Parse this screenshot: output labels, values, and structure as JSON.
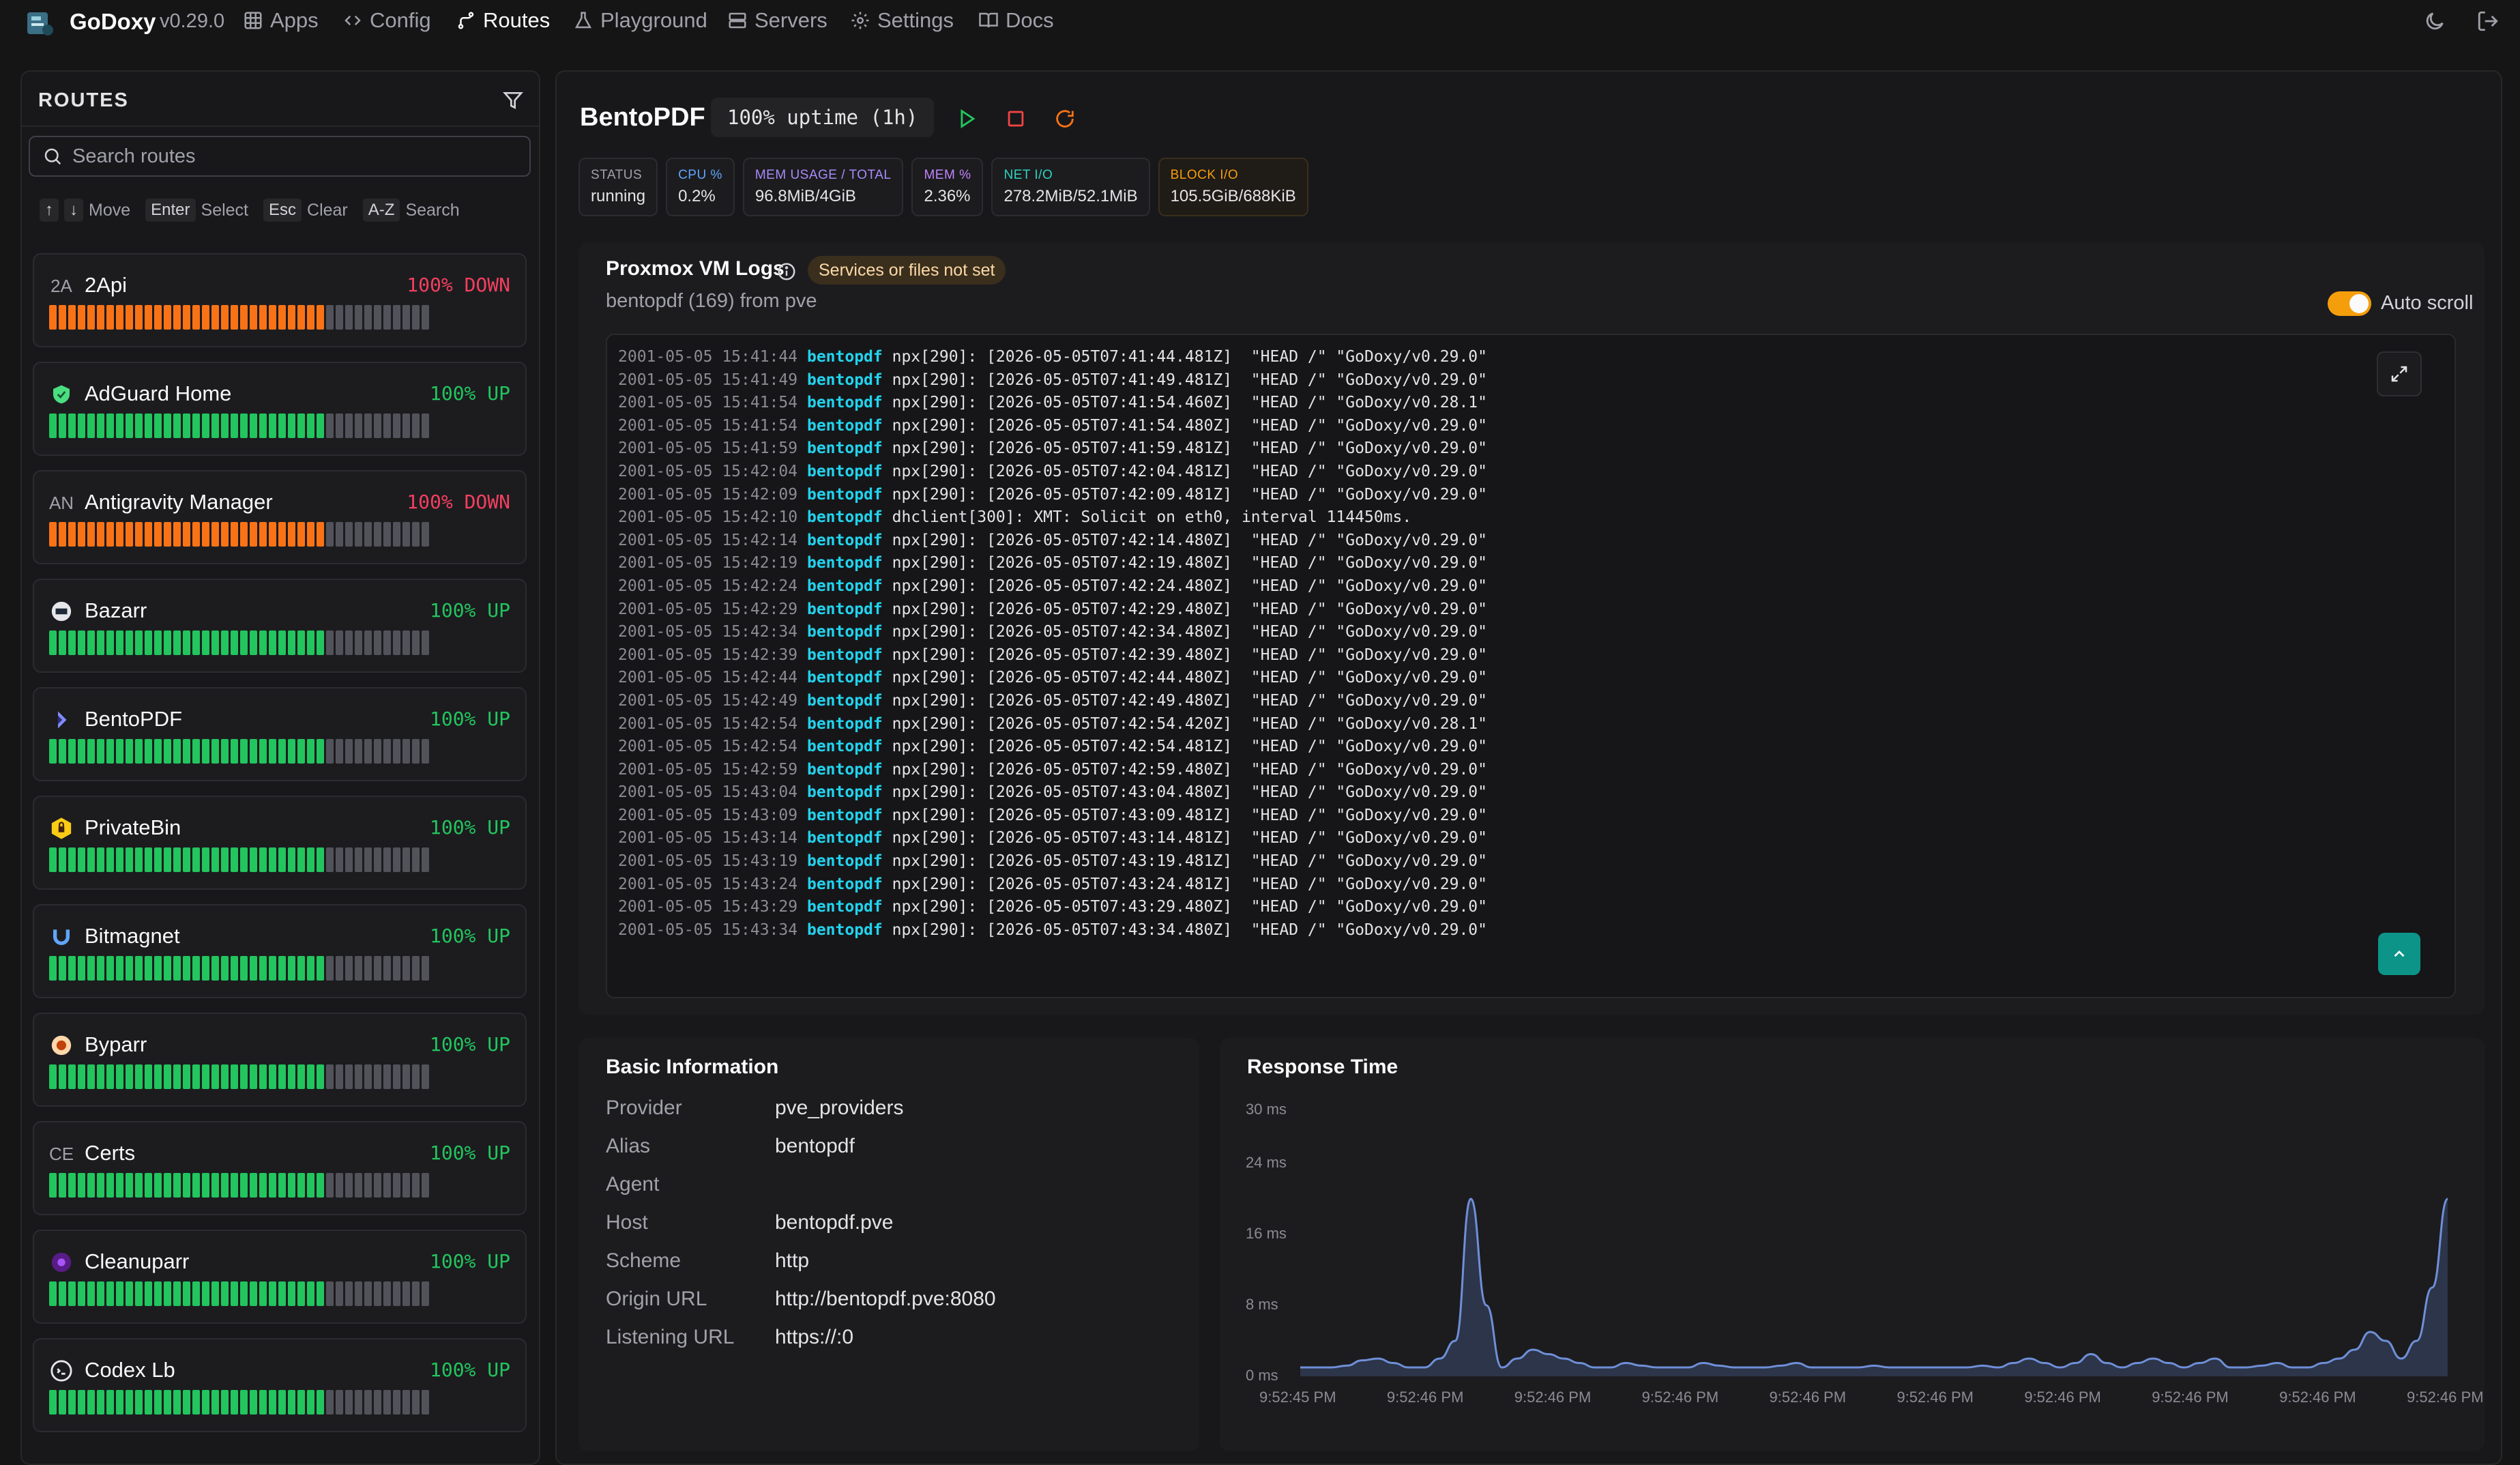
{
  "app": {
    "name": "GoDoxy",
    "version": "v0.29.0"
  },
  "nav": [
    {
      "label": "Apps",
      "icon": "grid-icon",
      "active": false
    },
    {
      "label": "Config",
      "icon": "code-icon",
      "active": false
    },
    {
      "label": "Routes",
      "icon": "route-icon",
      "active": true
    },
    {
      "label": "Playground",
      "icon": "flask-icon",
      "active": false
    },
    {
      "label": "Servers",
      "icon": "server-icon",
      "active": false
    },
    {
      "label": "Settings",
      "icon": "gear-icon",
      "active": false
    },
    {
      "label": "Docs",
      "icon": "book-icon",
      "active": false
    }
  ],
  "sidebar": {
    "title": "ROUTES",
    "search_placeholder": "Search routes",
    "hints": [
      {
        "keys": [
          "↑",
          "↓"
        ],
        "label": "Move"
      },
      {
        "keys": [
          "Enter"
        ],
        "label": "Select"
      },
      {
        "keys": [
          "Esc"
        ],
        "label": "Clear"
      },
      {
        "keys": [
          "A-Z"
        ],
        "label": "Search"
      }
    ],
    "routes": [
      {
        "name": "2Api",
        "icon_text": "2A",
        "status": "100% DOWN",
        "state": "down"
      },
      {
        "name": "AdGuard Home",
        "icon_text": "",
        "icon": "adguard-shield-icon",
        "status": "100% UP",
        "state": "up"
      },
      {
        "name": "Antigravity Manager",
        "icon_text": "AN",
        "status": "100% DOWN",
        "state": "down"
      },
      {
        "name": "Bazarr",
        "icon_text": "",
        "icon": "bazarr-icon",
        "status": "100% UP",
        "state": "up"
      },
      {
        "name": "BentoPDF",
        "icon_text": "",
        "icon": "bentopdf-icon",
        "status": "100% UP",
        "state": "up"
      },
      {
        "name": "PrivateBin",
        "icon_text": "",
        "icon": "privatebin-icon",
        "status": "100% UP",
        "state": "up"
      },
      {
        "name": "Bitmagnet",
        "icon_text": "",
        "icon": "magnet-icon",
        "status": "100% UP",
        "state": "up"
      },
      {
        "name": "Byparr",
        "icon_text": "",
        "icon": "byparr-icon",
        "status": "100% UP",
        "state": "up"
      },
      {
        "name": "Certs",
        "icon_text": "CE",
        "status": "100% UP",
        "state": "up"
      },
      {
        "name": "Cleanuparr",
        "icon_text": "",
        "icon": "cleanuparr-icon",
        "status": "100% UP",
        "state": "up"
      },
      {
        "name": "Codex Lb",
        "icon_text": "",
        "icon": "codex-icon",
        "status": "100% UP",
        "state": "up"
      }
    ]
  },
  "detail": {
    "title": "BentoPDF",
    "uptime": "100% uptime (1h)",
    "stats": [
      {
        "label": "STATUS",
        "value": "running",
        "color": "#a1a1aa"
      },
      {
        "label": "CPU %",
        "value": "0.2%",
        "color": "#60a5fa"
      },
      {
        "label": "MEM USAGE / TOTAL",
        "value": "96.8MiB/4GiB",
        "color": "#a78bfa"
      },
      {
        "label": "MEM %",
        "value": "2.36%",
        "color": "#c084fc"
      },
      {
        "label": "NET I/O",
        "value": "278.2MiB/52.1MiB",
        "color": "#2dd4bf"
      },
      {
        "label": "BLOCK I/O",
        "value": "105.5GiB/688KiB",
        "color": "#f59e0b"
      }
    ]
  },
  "logs": {
    "title": "Proxmox VM Logs",
    "badge": "Services or files not set",
    "subtitle": "bentopdf (169) from pve",
    "auto_scroll_label": "Auto scroll",
    "auto_scroll": true,
    "lines": [
      {
        "ts": "2001-05-05 15:41:44",
        "host": "bentopdf",
        "msg": "npx[290]: [2026-05-05T07:41:44.481Z]  \"HEAD /\" \"GoDoxy/v0.29.0\""
      },
      {
        "ts": "2001-05-05 15:41:49",
        "host": "bentopdf",
        "msg": "npx[290]: [2026-05-05T07:41:49.481Z]  \"HEAD /\" \"GoDoxy/v0.29.0\""
      },
      {
        "ts": "2001-05-05 15:41:54",
        "host": "bentopdf",
        "msg": "npx[290]: [2026-05-05T07:41:54.460Z]  \"HEAD /\" \"GoDoxy/v0.28.1\""
      },
      {
        "ts": "2001-05-05 15:41:54",
        "host": "bentopdf",
        "msg": "npx[290]: [2026-05-05T07:41:54.480Z]  \"HEAD /\" \"GoDoxy/v0.29.0\""
      },
      {
        "ts": "2001-05-05 15:41:59",
        "host": "bentopdf",
        "msg": "npx[290]: [2026-05-05T07:41:59.481Z]  \"HEAD /\" \"GoDoxy/v0.29.0\""
      },
      {
        "ts": "2001-05-05 15:42:04",
        "host": "bentopdf",
        "msg": "npx[290]: [2026-05-05T07:42:04.481Z]  \"HEAD /\" \"GoDoxy/v0.29.0\""
      },
      {
        "ts": "2001-05-05 15:42:09",
        "host": "bentopdf",
        "msg": "npx[290]: [2026-05-05T07:42:09.481Z]  \"HEAD /\" \"GoDoxy/v0.29.0\""
      },
      {
        "ts": "2001-05-05 15:42:10",
        "host": "bentopdf",
        "msg": "dhclient[300]: XMT: Solicit on eth0, interval 114450ms."
      },
      {
        "ts": "2001-05-05 15:42:14",
        "host": "bentopdf",
        "msg": "npx[290]: [2026-05-05T07:42:14.480Z]  \"HEAD /\" \"GoDoxy/v0.29.0\""
      },
      {
        "ts": "2001-05-05 15:42:19",
        "host": "bentopdf",
        "msg": "npx[290]: [2026-05-05T07:42:19.480Z]  \"HEAD /\" \"GoDoxy/v0.29.0\""
      },
      {
        "ts": "2001-05-05 15:42:24",
        "host": "bentopdf",
        "msg": "npx[290]: [2026-05-05T07:42:24.480Z]  \"HEAD /\" \"GoDoxy/v0.29.0\""
      },
      {
        "ts": "2001-05-05 15:42:29",
        "host": "bentopdf",
        "msg": "npx[290]: [2026-05-05T07:42:29.480Z]  \"HEAD /\" \"GoDoxy/v0.29.0\""
      },
      {
        "ts": "2001-05-05 15:42:34",
        "host": "bentopdf",
        "msg": "npx[290]: [2026-05-05T07:42:34.480Z]  \"HEAD /\" \"GoDoxy/v0.29.0\""
      },
      {
        "ts": "2001-05-05 15:42:39",
        "host": "bentopdf",
        "msg": "npx[290]: [2026-05-05T07:42:39.480Z]  \"HEAD /\" \"GoDoxy/v0.29.0\""
      },
      {
        "ts": "2001-05-05 15:42:44",
        "host": "bentopdf",
        "msg": "npx[290]: [2026-05-05T07:42:44.480Z]  \"HEAD /\" \"GoDoxy/v0.29.0\""
      },
      {
        "ts": "2001-05-05 15:42:49",
        "host": "bentopdf",
        "msg": "npx[290]: [2026-05-05T07:42:49.480Z]  \"HEAD /\" \"GoDoxy/v0.29.0\""
      },
      {
        "ts": "2001-05-05 15:42:54",
        "host": "bentopdf",
        "msg": "npx[290]: [2026-05-05T07:42:54.420Z]  \"HEAD /\" \"GoDoxy/v0.28.1\""
      },
      {
        "ts": "2001-05-05 15:42:54",
        "host": "bentopdf",
        "msg": "npx[290]: [2026-05-05T07:42:54.481Z]  \"HEAD /\" \"GoDoxy/v0.29.0\""
      },
      {
        "ts": "2001-05-05 15:42:59",
        "host": "bentopdf",
        "msg": "npx[290]: [2026-05-05T07:42:59.480Z]  \"HEAD /\" \"GoDoxy/v0.29.0\""
      },
      {
        "ts": "2001-05-05 15:43:04",
        "host": "bentopdf",
        "msg": "npx[290]: [2026-05-05T07:43:04.480Z]  \"HEAD /\" \"GoDoxy/v0.29.0\""
      },
      {
        "ts": "2001-05-05 15:43:09",
        "host": "bentopdf",
        "msg": "npx[290]: [2026-05-05T07:43:09.481Z]  \"HEAD /\" \"GoDoxy/v0.29.0\""
      },
      {
        "ts": "2001-05-05 15:43:14",
        "host": "bentopdf",
        "msg": "npx[290]: [2026-05-05T07:43:14.481Z]  \"HEAD /\" \"GoDoxy/v0.29.0\""
      },
      {
        "ts": "2001-05-05 15:43:19",
        "host": "bentopdf",
        "msg": "npx[290]: [2026-05-05T07:43:19.481Z]  \"HEAD /\" \"GoDoxy/v0.29.0\""
      },
      {
        "ts": "2001-05-05 15:43:24",
        "host": "bentopdf",
        "msg": "npx[290]: [2026-05-05T07:43:24.481Z]  \"HEAD /\" \"GoDoxy/v0.29.0\""
      },
      {
        "ts": "2001-05-05 15:43:29",
        "host": "bentopdf",
        "msg": "npx[290]: [2026-05-05T07:43:29.480Z]  \"HEAD /\" \"GoDoxy/v0.29.0\""
      },
      {
        "ts": "2001-05-05 15:43:34",
        "host": "bentopdf",
        "msg": "npx[290]: [2026-05-05T07:43:34.480Z]  \"HEAD /\" \"GoDoxy/v0.29.0\""
      }
    ]
  },
  "basic_info": {
    "title": "Basic Information",
    "rows": [
      {
        "key": "Provider",
        "value": "pve_providers"
      },
      {
        "key": "Alias",
        "value": "bentopdf"
      },
      {
        "key": "Agent",
        "value": ""
      },
      {
        "key": "Host",
        "value": "bentopdf.pve"
      },
      {
        "key": "Scheme",
        "value": "http"
      },
      {
        "key": "Origin URL",
        "value": "http://bentopdf.pve:8080"
      },
      {
        "key": "Listening URL",
        "value": "https://:0"
      }
    ]
  },
  "chart_data": {
    "type": "area",
    "title": "Response Time",
    "y_ticks": [
      "30 ms",
      "24 ms",
      "16 ms",
      "8 ms",
      "0 ms"
    ],
    "ylim": [
      0,
      30
    ],
    "x_ticks": [
      "9:52:45 PM",
      "9:52:46 PM",
      "9:52:46 PM",
      "9:52:46 PM",
      "9:52:46 PM",
      "9:52:46 PM",
      "9:52:46 PM",
      "9:52:46 PM",
      "9:52:46 PM",
      "9:52:46 PM"
    ],
    "values": [
      1,
      1,
      1,
      1.2,
      1.8,
      2,
      1.5,
      1,
      1,
      2,
      4,
      20,
      8,
      1,
      2,
      3,
      2.5,
      2,
      1.5,
      1,
      1,
      1.5,
      1.2,
      1,
      1,
      1,
      1.5,
      1.2,
      1,
      1,
      1,
      1.2,
      1.5,
      1,
      1,
      1,
      1,
      1.2,
      1,
      1,
      1,
      1,
      1,
      1,
      1.2,
      1,
      1.5,
      2,
      1.5,
      1,
      1.5,
      2.5,
      1.5,
      1,
      1.5,
      2,
      1.5,
      1,
      1.5,
      2,
      1,
      1,
      1.2,
      1.5,
      1,
      1,
      1.5,
      2,
      3,
      5,
      4,
      2,
      4,
      10,
      20
    ],
    "color": "#6f8fd8"
  },
  "colors": {
    "up": "#22c55e",
    "down": "#f97316",
    "empty": "#52525b",
    "accent": "#0d9488"
  }
}
